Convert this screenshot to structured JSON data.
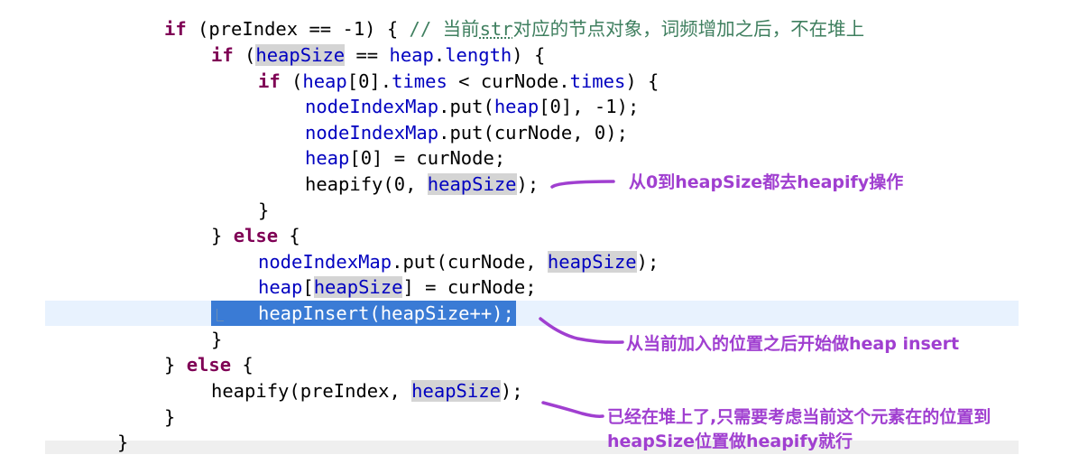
{
  "code": {
    "l1": {
      "if": "if",
      "a": " (preIndex == -1) { ",
      "comment_slash": "// ",
      "comment_text": "当前",
      "comment_code": "str",
      "comment_rest": "对应的节点对象，词频增加之后，不在堆上"
    },
    "l2": {
      "if": "if",
      "a": " (",
      "heapSize": "heapSize",
      "b": " == ",
      "heap": "heap",
      "c": ".",
      "length": "length",
      "d": ") {"
    },
    "l3": {
      "if": "if",
      "a": " (",
      "heap": "heap",
      "b": "[0].",
      "times1": "times",
      "c": " < curNode.",
      "times2": "times",
      "d": ") {"
    },
    "l4": {
      "a": "nodeIndexMap",
      "b": ".put(",
      "heap": "heap",
      "c": "[0], -1);"
    },
    "l5": {
      "a": "nodeIndexMap",
      "b": ".put(curNode, 0);"
    },
    "l6": {
      "heap": "heap",
      "a": "[0] = curNode;"
    },
    "l7": {
      "a": "heapify(0, ",
      "heapSize": "heapSize",
      "b": ");"
    },
    "l8": {
      "a": "}"
    },
    "l9": {
      "a": "} ",
      "else": "else",
      "b": " {"
    },
    "l10": {
      "a": "nodeIndexMap",
      "b": ".put(curNode, ",
      "heapSize": "heapSize",
      "c": ");"
    },
    "l11": {
      "heap": "heap",
      "a": "[",
      "heapSize": "heapSize",
      "b": "] = curNode;"
    },
    "l12": {
      "a": "heapInsert(heapSize++);"
    },
    "l13": {
      "a": "}"
    },
    "l14": {
      "a": "} ",
      "else": "else",
      "b": " {"
    },
    "l15": {
      "a": "heapify(preIndex, ",
      "heapSize": "heapSize",
      "b": ");"
    },
    "l16": {
      "a": "}"
    },
    "l17": {
      "a": "}"
    }
  },
  "annotations": {
    "a1": "从0到heapSize都去heapify操作",
    "a2": "从当前加入的位置之后开始做heap insert",
    "a3_line1": "已经在堆上了,只需要考虑当前这个元素在的位置到",
    "a3_line2": "heapSize位置做heapify就行"
  },
  "colors": {
    "keyword": "#7f0055",
    "field": "#0000c0",
    "comment": "#3f7f5f",
    "selection": "#3a7bd5",
    "current_line": "#e8f2fe",
    "annotation": "#a03fd0"
  }
}
